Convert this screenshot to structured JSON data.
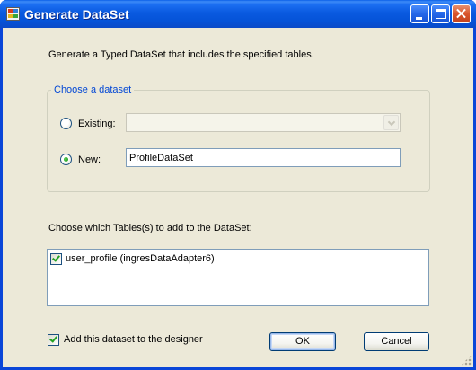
{
  "window": {
    "title": "Generate DataSet"
  },
  "dialog": {
    "description": "Generate a Typed DataSet that includes the specified tables.",
    "dataset_group": {
      "legend": "Choose a dataset",
      "existing_label": "Existing:",
      "existing_value": "",
      "new_label": "New:",
      "new_value": "ProfileDataSet",
      "selected": "new"
    },
    "tables_label": "Choose which Tables(s) to add to the DataSet:",
    "tables": [
      {
        "label": "user_profile (ingresDataAdapter6)",
        "checked": true
      }
    ],
    "add_to_designer_label": "Add this dataset to the designer",
    "add_to_designer_checked": true,
    "ok_label": "OK",
    "cancel_label": "Cancel"
  },
  "icons": {
    "app": "dataset-app-icon",
    "minimize": "minimize-icon",
    "maximize": "maximize-icon",
    "close": "close-icon",
    "dropdown": "chevron-down-icon",
    "resize": "resize-grip-icon"
  },
  "colors": {
    "titlebar": "#0553d8",
    "client_bg": "#ece9d8",
    "legend_text": "#0046d5",
    "check_green": "#21a121"
  }
}
